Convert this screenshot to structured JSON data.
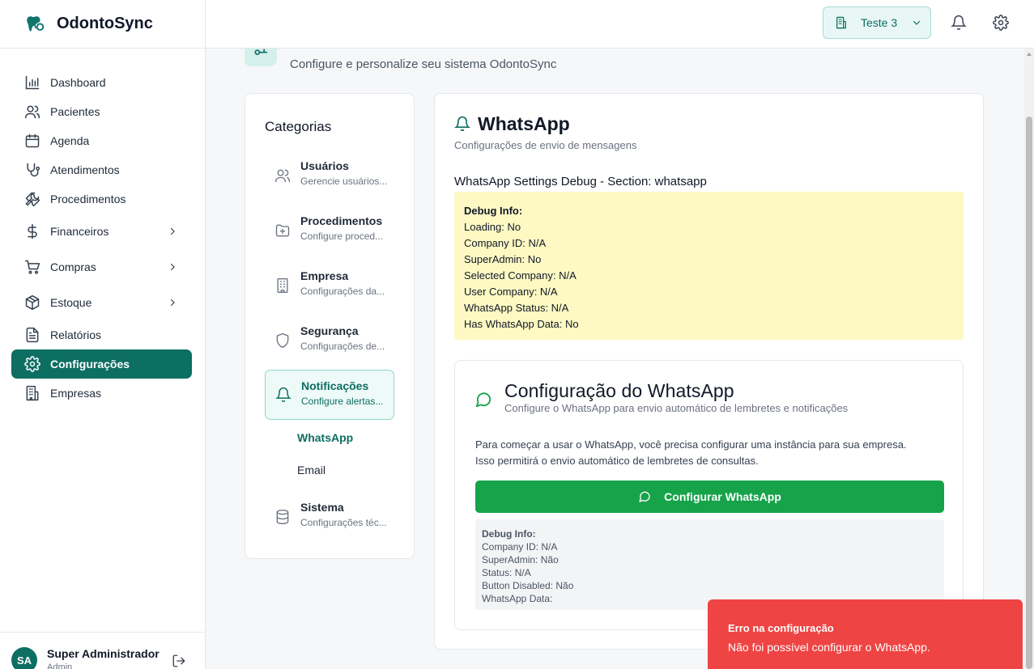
{
  "app": {
    "name": "OdontoSync"
  },
  "sidebar": {
    "items": [
      {
        "label": "Dashboard",
        "icon": "bar-chart-icon"
      },
      {
        "label": "Pacientes",
        "icon": "users-icon"
      },
      {
        "label": "Agenda",
        "icon": "calendar-icon"
      },
      {
        "label": "Atendimentos",
        "icon": "stethoscope-icon"
      },
      {
        "label": "Procedimentos",
        "icon": "wrench-icon"
      },
      {
        "label": "Financeiros",
        "icon": "dollar-icon"
      },
      {
        "label": "Compras",
        "icon": "cart-icon"
      },
      {
        "label": "Estoque",
        "icon": "box-icon"
      },
      {
        "label": "Relatórios",
        "icon": "report-icon"
      },
      {
        "label": "Configurações",
        "icon": "gear-icon"
      },
      {
        "label": "Empresas",
        "icon": "building-icon"
      }
    ],
    "active": "Configurações",
    "user": {
      "initials": "SA",
      "name": "Super Administrador",
      "role": "Admin"
    }
  },
  "header": {
    "company": "Teste 3"
  },
  "page": {
    "subtitle": "Configure e personalize seu sistema OdontoSync"
  },
  "categories": {
    "title": "Categorias",
    "items": [
      {
        "title": "Usuários",
        "subtitle": "Gerencie usuários..."
      },
      {
        "title": "Procedimentos",
        "subtitle": "Configure proced..."
      },
      {
        "title": "Empresa",
        "subtitle": "Configurações da..."
      },
      {
        "title": "Segurança",
        "subtitle": "Configurações de..."
      },
      {
        "title": "Notificações",
        "subtitle": "Configure alertas..."
      },
      {
        "title": "Sistema",
        "subtitle": "Configurações téc..."
      }
    ],
    "subitems": [
      "WhatsApp",
      "Email"
    ]
  },
  "whatsapp": {
    "title": "WhatsApp",
    "subtitle": "Configurações de envio de mensagens",
    "debug_heading": "WhatsApp Settings Debug - Section: whatsapp",
    "debug_title": "Debug Info:",
    "debug_lines": [
      "Loading: No",
      "Company ID: N/A",
      "SuperAdmin: No",
      "Selected Company: N/A",
      "User Company: N/A",
      "WhatsApp Status: N/A",
      "Has WhatsApp Data: No"
    ],
    "card": {
      "title": "Configuração do WhatsApp",
      "subtitle": "Configure o WhatsApp para envio automático de lembretes e notificações",
      "paragraph1": "Para começar a usar o WhatsApp, você precisa configurar uma instância para sua empresa.",
      "paragraph2": "Isso permitirá o envio automático de lembretes de consultas.",
      "button": "Configurar WhatsApp",
      "debug_title": "Debug Info:",
      "debug_lines": [
        "Company ID: N/A",
        "SuperAdmin: Não",
        "Status: N/A",
        "Button Disabled: Não",
        "WhatsApp Data:"
      ]
    }
  },
  "toast": {
    "title": "Erro na configuração",
    "message": "Não foi possível configurar o WhatsApp."
  },
  "colors": {
    "primary": "#0d6e62",
    "whatsapp_green": "#16a34a",
    "debug_yellow": "#fef9c3",
    "error_red": "#ef4444"
  }
}
